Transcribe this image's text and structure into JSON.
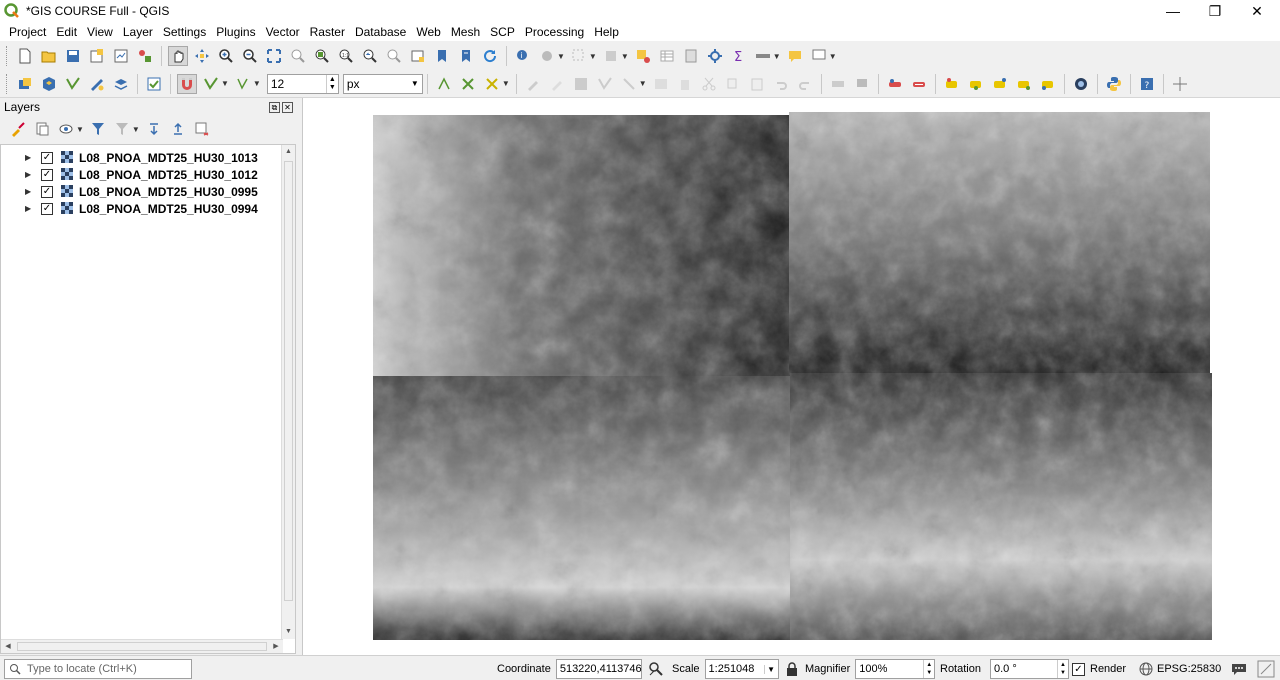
{
  "window": {
    "title": "*GIS COURSE Full - QGIS",
    "minimize": "—",
    "restore": "❐",
    "close": "✕"
  },
  "menu": [
    "Project",
    "Edit",
    "View",
    "Layer",
    "Settings",
    "Plugins",
    "Vector",
    "Raster",
    "Database",
    "Web",
    "Mesh",
    "SCP",
    "Processing",
    "Help"
  ],
  "toolbar2": {
    "tolerance_value": "12",
    "unit": "px"
  },
  "layers_panel": {
    "title": "Layers",
    "layers": [
      {
        "name": "L08_PNOA_MDT25_HU30_1013",
        "checked": "✓"
      },
      {
        "name": "L08_PNOA_MDT25_HU30_1012",
        "checked": "✓"
      },
      {
        "name": "L08_PNOA_MDT25_HU30_0995",
        "checked": "✓"
      },
      {
        "name": "L08_PNOA_MDT25_HU30_0994",
        "checked": "✓"
      }
    ]
  },
  "statusbar": {
    "locator_placeholder": "Type to locate (Ctrl+K)",
    "coordinate_label": "Coordinate",
    "coordinate_value": "513220,4113746",
    "scale_label": "Scale",
    "scale_value": "1:251048",
    "magnifier_label": "Magnifier",
    "magnifier_value": "100%",
    "rotation_label": "Rotation",
    "rotation_value": "0.0 °",
    "render_label": "Render",
    "render_checked": "✓",
    "crs": "EPSG:25830"
  },
  "colors": {
    "accent_green": "#589632",
    "panel_bg": "#f0f0f0",
    "canvas_bg": "#ffffff"
  }
}
